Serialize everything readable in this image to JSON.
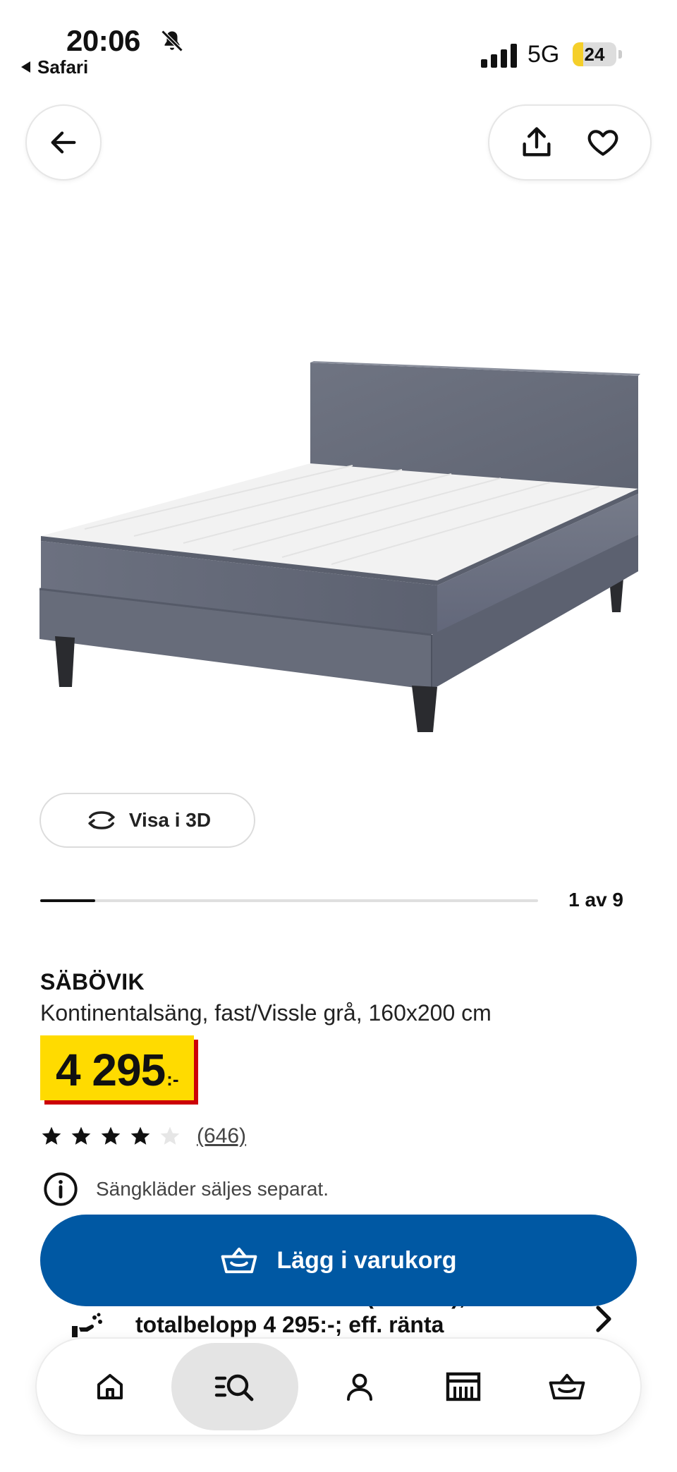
{
  "status_bar": {
    "time": "20:06",
    "back_app": "Safari",
    "network": "5G",
    "battery_level": "24",
    "battery_fraction": 0.24,
    "battery_color": "#f5cf2a"
  },
  "header": {
    "back_icon": "arrow-left-icon",
    "share_icon": "share-icon",
    "favorite_icon": "heart-icon"
  },
  "gallery": {
    "view_3d_label": "Visa i 3D",
    "position_label": "1 av 9",
    "progress_fraction": 0.11
  },
  "product": {
    "brand": "SÄBÖVIK",
    "description": "Kontinentalsäng, fast/Vissle grå, 160x200 cm",
    "price": "4 295",
    "price_suffix": ":-",
    "rating_stars": 4,
    "rating_max": 5,
    "rating_count": "(646)",
    "notice": "Sängkläder säljes separat."
  },
  "actions": {
    "add_to_cart": "Lägg i varukorg"
  },
  "financing": {
    "line_1": "Delbetala 429:- / mån (10 mån),",
    "line_2": "totalbelopp 4 295:-; eff. ränta"
  },
  "tab_bar": {
    "items": [
      {
        "name": "home",
        "icon": "home-icon"
      },
      {
        "name": "search",
        "icon": "search-list-icon",
        "active": true
      },
      {
        "name": "profile",
        "icon": "person-icon"
      },
      {
        "name": "store",
        "icon": "store-icon"
      },
      {
        "name": "cart",
        "icon": "basket-icon"
      }
    ]
  },
  "colors": {
    "accent_blue": "#0058a3",
    "price_yellow": "#ffdb00",
    "price_red": "#cc0008"
  }
}
